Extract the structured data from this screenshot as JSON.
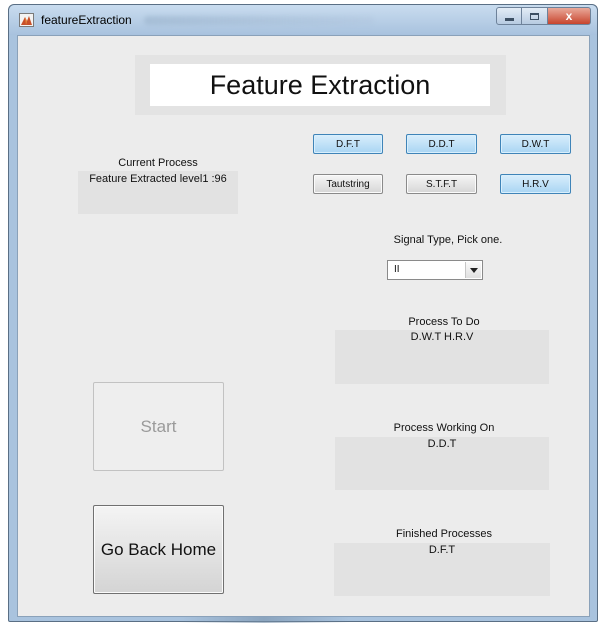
{
  "window": {
    "title": "featureExtraction",
    "icon": "matlab-figure-icon",
    "controls": {
      "minimize_icon": "minimize-icon",
      "maximize_icon": "maximize-icon",
      "close_icon": "close-icon",
      "close_glyph": "x"
    }
  },
  "header": {
    "title": "Feature Extraction"
  },
  "current_process": {
    "label": "Current Process",
    "value": "Feature Extracted level1 :96"
  },
  "process_buttons": {
    "dft": "D.F.T",
    "ddt": "D.D.T",
    "dwt": "D.W.T",
    "tautstring": "Tautstring",
    "stft": "S.T.F.T",
    "hrv": "H.R.V"
  },
  "signal_type": {
    "label": "Signal Type, Pick one.",
    "selected": "II"
  },
  "process_to_do": {
    "label": "Process To Do",
    "value": "D.W.T  H.R.V"
  },
  "process_working_on": {
    "label": "Process Working On",
    "value": "D.D.T"
  },
  "finished_processes": {
    "label": "Finished Processes",
    "value": "D.F.T"
  },
  "actions": {
    "start": "Start",
    "go_back_home": "Go Back Home"
  },
  "colors": {
    "selected_button": "#a9d5f3",
    "unselected_button": "#d6d6d6",
    "panel_background": "#ececec",
    "status_box": "#e2e2e2"
  }
}
